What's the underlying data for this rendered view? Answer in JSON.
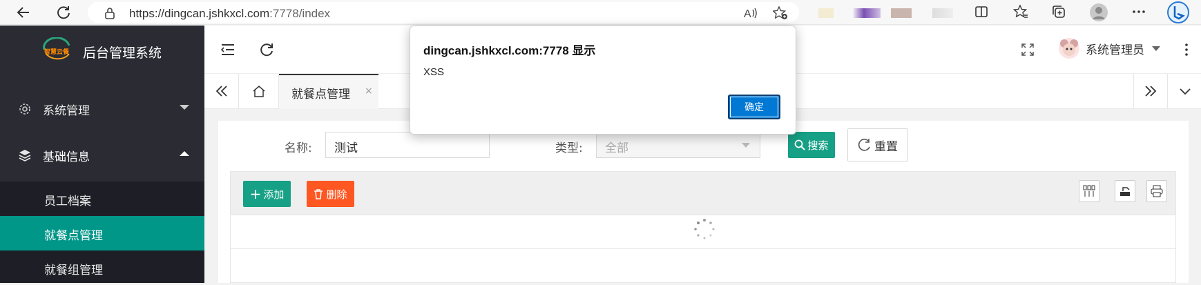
{
  "browser": {
    "url": "https://dingcan.jshkxcl.com:7778/index",
    "url_host_part": "https://dingcan.jshkxcl.com",
    "url_rest_part": ":7778/index"
  },
  "app": {
    "title": "后台管理系统",
    "logo_text": "智慧云餐",
    "accent_color": "#009688"
  },
  "sidebar": {
    "menu": [
      {
        "label": "系统管理",
        "icon": "gear-icon",
        "expanded": false
      },
      {
        "label": "基础信息",
        "icon": "layers-icon",
        "expanded": true
      }
    ],
    "sub_items": [
      {
        "label": "员工档案",
        "active": false
      },
      {
        "label": "就餐点管理",
        "active": true
      },
      {
        "label": "就餐组管理",
        "active": false
      }
    ]
  },
  "header": {
    "user_name": "系统管理员"
  },
  "tabs": {
    "active_label": "就餐点管理",
    "close_glyph": "×"
  },
  "search": {
    "name_label": "名称:",
    "name_value": "测试",
    "type_label": "类型:",
    "type_value": "全部",
    "search_button": "搜索",
    "reset_button": "重置"
  },
  "toolbar": {
    "add_button": "添加",
    "delete_button": "删除"
  },
  "dialog": {
    "title": "dingcan.jshkxcl.com:7778 显示",
    "message": "XSS",
    "ok_button": "确定"
  }
}
